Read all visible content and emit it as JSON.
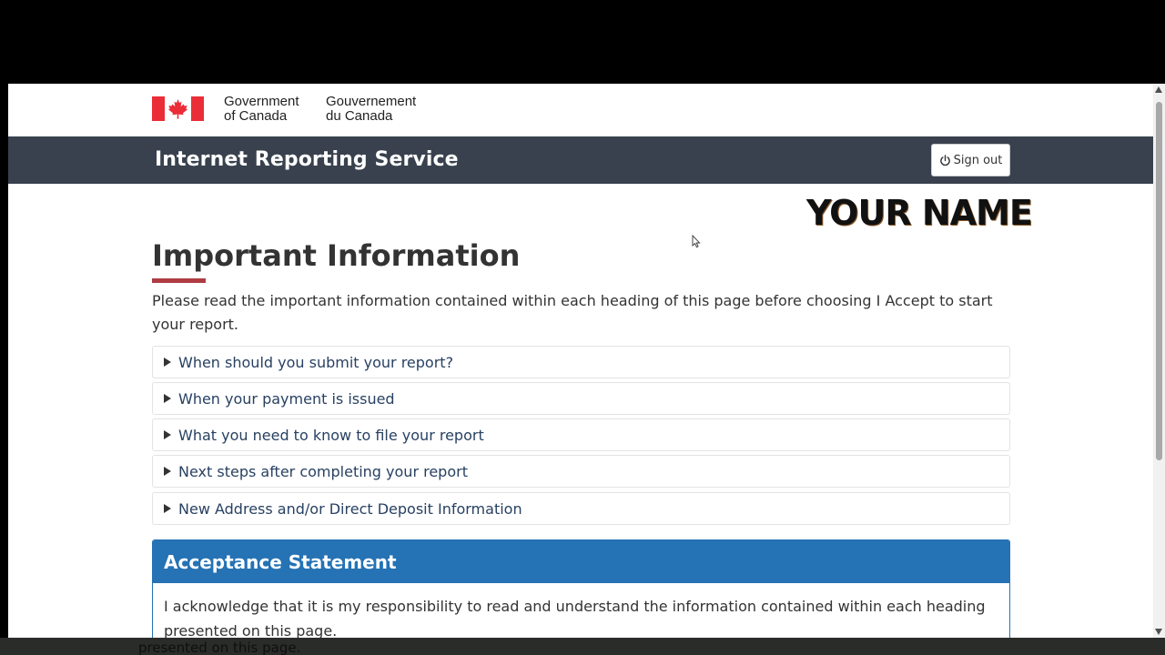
{
  "gov": {
    "en_line1": "Government",
    "en_line2": "of Canada",
    "fr_line1": "Gouvernement",
    "fr_line2": "du Canada",
    "flag_red": "#eb2d37"
  },
  "app": {
    "title": "Internet Reporting Service",
    "signout_label": "Sign out",
    "bar_color": "#38414d"
  },
  "overlay": {
    "name": "YOUR NAME"
  },
  "page": {
    "title": "Important Information",
    "intro": "Please read the important information contained within each heading of this page before choosing I Accept to start your report."
  },
  "accordion": [
    {
      "label": "When should you submit your report?"
    },
    {
      "label": "When your payment is issued"
    },
    {
      "label": "What you need to know to file your report"
    },
    {
      "label": "Next steps after completing your report"
    },
    {
      "label": "New Address and/or Direct Deposit Information"
    }
  ],
  "acceptance": {
    "title": "Acceptance Statement",
    "body": "I acknowledge that it is my responsibility to read and understand the information contained within each heading presented on this page.",
    "header_color": "#2572b4"
  },
  "bottom": {
    "ghost_text": "presented on this page."
  }
}
